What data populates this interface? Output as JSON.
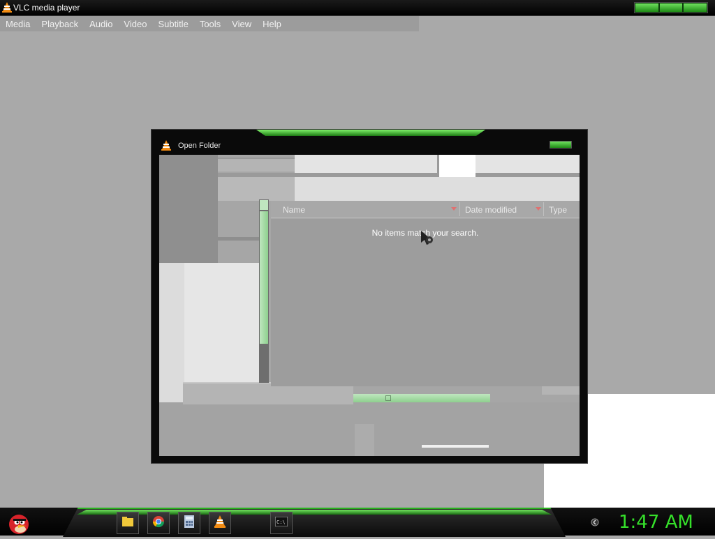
{
  "window": {
    "title": "VLC media player"
  },
  "menu": [
    "Media",
    "Playback",
    "Audio",
    "Video",
    "Subtitle",
    "Tools",
    "View",
    "Help"
  ],
  "dialog": {
    "title": "Open Folder",
    "columns": {
      "name": "Name",
      "date_modified": "Date modified",
      "type": "Type"
    },
    "empty_message": "No items match your search."
  },
  "taskbar": {
    "clock": "1:47 AM",
    "apps": [
      "file-explorer-icon",
      "chrome-icon",
      "calculator-icon",
      "vlc-icon",
      "command-prompt-icon"
    ]
  },
  "colors": {
    "accent_green": "#35e02a",
    "desktop_gray": "#a9a9a9"
  }
}
